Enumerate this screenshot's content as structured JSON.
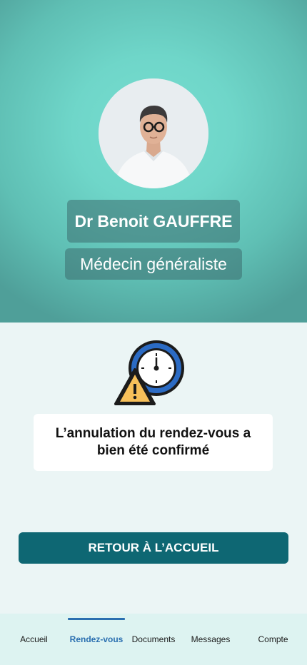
{
  "doctor": {
    "name": "Dr Benoit GAUFFRE",
    "specialty": "Médecin généraliste"
  },
  "message": {
    "text": "L’annulation du rendez-vous a bien été confirmé"
  },
  "actions": {
    "home_label": "RETOUR À L’ACCUEIL"
  },
  "tabbar": {
    "items": [
      {
        "label": "Accueil",
        "active": false
      },
      {
        "label": "Rendez-vous",
        "active": true
      },
      {
        "label": "Documents",
        "active": false
      },
      {
        "label": "Messages",
        "active": false
      },
      {
        "label": "Compte",
        "active": false
      }
    ]
  },
  "colors": {
    "hero_teal": "#6fd6c9",
    "primary_button": "#0e6773",
    "active_tab": "#2a6fb0",
    "warning_yellow": "#f7c05a",
    "clock_blue": "#2b6bc4"
  },
  "icons": {
    "alert": "clock-warning-icon",
    "avatar": "doctor-photo"
  }
}
